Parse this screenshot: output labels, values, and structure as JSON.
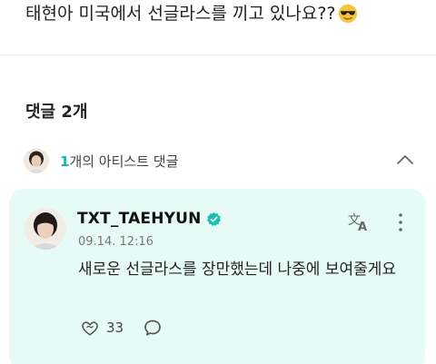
{
  "post": {
    "text": "태현아 미국에서 선글라스를 끼고 있나요??",
    "emoji_icon": "sunglasses-emoji"
  },
  "comments_header": {
    "label": "댓글 2개"
  },
  "artist_comments_toggle": {
    "count": "1",
    "label": "개의 아티스트 댓글",
    "icon": "chevron-up-icon"
  },
  "comment": {
    "author": "TXT_TAEHYUN",
    "verified_icon": "verified-badge-icon",
    "time": "09.14. 12:16",
    "body": "새로운 선글라스를 장만했는데 나중에 보여줄게요",
    "like_count": "33",
    "translate_icon": "translate-icon",
    "more_icon": "more-vertical-icon",
    "reply_icon": "reply-bubble-icon"
  },
  "colors": {
    "accent": "#12b5b0",
    "card_background": "#e7fbf6"
  }
}
